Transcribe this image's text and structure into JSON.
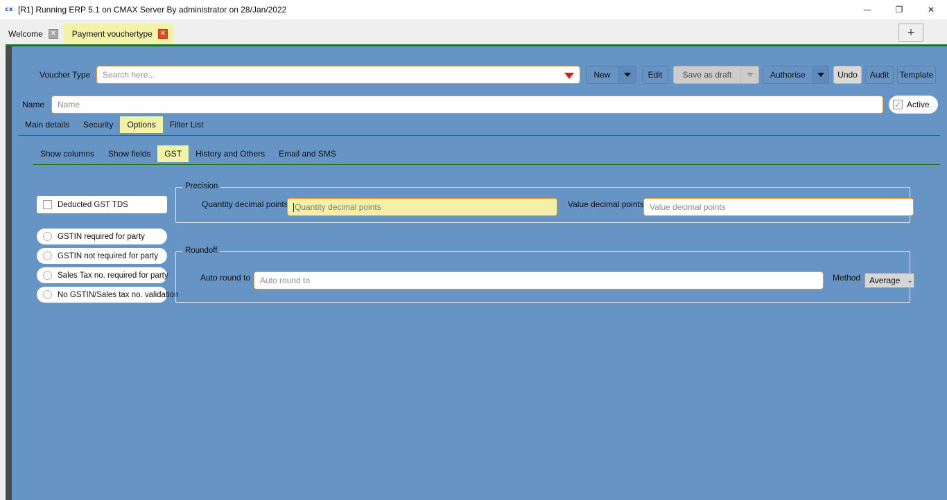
{
  "window": {
    "title": "[R1] Running ERP 5.1 on CMAX Server By administrator on 28/Jan/2022",
    "app_icon": "cx",
    "minimize_icon": "—",
    "maximize_icon": "❐",
    "close_icon": "✕"
  },
  "tabstrip": {
    "tabs": [
      {
        "label": "Welcome",
        "close_icon": "✕",
        "active": false
      },
      {
        "label": "Payment vouchertype",
        "close_icon": "✕",
        "active": true
      }
    ],
    "new_tab_icon": "+"
  },
  "toolbar": {
    "voucher_type_label": "Voucher Type",
    "voucher_type_placeholder": "Search here...",
    "new_label": "New",
    "edit_label": "Edit",
    "save_as_draft_label": "Save as draft",
    "authorise_label": "Authorise",
    "undo_label": "Undo",
    "audit_label": "Audit",
    "template_label": "Template"
  },
  "name_row": {
    "label": "Name",
    "placeholder": "Name",
    "active_label": "Active",
    "active_checked_icon": "✓"
  },
  "primary_tabs": [
    {
      "label": "Main details",
      "selected": false
    },
    {
      "label": "Security",
      "selected": false
    },
    {
      "label": "Options",
      "selected": true
    },
    {
      "label": "Filter List",
      "selected": false
    }
  ],
  "secondary_tabs": [
    {
      "label": "Show columns",
      "selected": false
    },
    {
      "label": "Show fields",
      "selected": false
    },
    {
      "label": "GST",
      "selected": true
    },
    {
      "label": "History and Others",
      "selected": false
    },
    {
      "label": "Email and SMS",
      "selected": false
    }
  ],
  "options": {
    "checkbox": {
      "label": "Deducted GST TDS",
      "checked": false
    },
    "radios": [
      {
        "label": "GSTIN required for party",
        "checked": false
      },
      {
        "label": "GSTIN not required for party",
        "checked": false
      },
      {
        "label": "Sales Tax no. required for party",
        "checked": false
      },
      {
        "label": "No GSTIN/Sales tax no. validation",
        "checked": false
      }
    ]
  },
  "precision": {
    "title": "Precision",
    "quantity_label": "Quantity decimal points",
    "quantity_placeholder": "Quantity decimal points",
    "quantity_value": "",
    "value_label": "Value decimal points",
    "value_placeholder": "Value decimal points",
    "value_value": ""
  },
  "roundoff": {
    "title": "Roundoff",
    "auto_round_label": "Auto round to",
    "auto_round_placeholder": "Auto round to",
    "auto_round_value": "",
    "method_label": "Method",
    "method_value": "Average",
    "method_chevron": "⌄"
  },
  "colors": {
    "canvas": "#6694c4",
    "accent_green": "#1a7a1a",
    "highlight_yellow": "#f2f2a8",
    "field_border": "#e79a2a",
    "focus_field_bg": "#f5f0a8",
    "close_red": "#e24a20"
  }
}
